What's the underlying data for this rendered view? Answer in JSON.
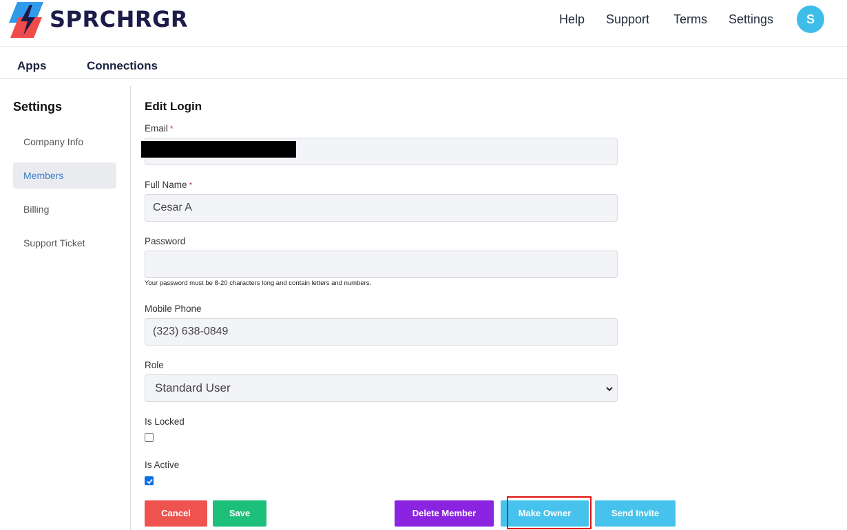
{
  "header": {
    "brand": "SPRCHRGR",
    "nav": [
      "Help",
      "Support",
      "Terms",
      "Settings"
    ],
    "avatar_initial": "S"
  },
  "subnav": [
    "Apps",
    "Connections"
  ],
  "sidebar": {
    "title": "Settings",
    "items": [
      {
        "label": "Company Info",
        "active": false
      },
      {
        "label": "Members",
        "active": true
      },
      {
        "label": "Billing",
        "active": false
      },
      {
        "label": "Support Ticket",
        "active": false
      }
    ]
  },
  "form": {
    "title": "Edit Login",
    "email": {
      "label": "Email",
      "required_mark": "*",
      "value": ""
    },
    "full_name": {
      "label": "Full Name",
      "required_mark": "*",
      "value": "Cesar A"
    },
    "password": {
      "label": "Password",
      "value": "",
      "hint": "Your password must be 8-20 characters long and contain letters and numbers."
    },
    "mobile_phone": {
      "label": "Mobile Phone",
      "value": "(323) 638-0849"
    },
    "role": {
      "label": "Role",
      "value": "Standard User"
    },
    "is_locked": {
      "label": "Is Locked",
      "checked": false
    },
    "is_active": {
      "label": "Is Active",
      "checked": true
    }
  },
  "buttons": {
    "cancel": "Cancel",
    "save": "Save",
    "delete_member": "Delete Member",
    "make_owner": "Make Owner",
    "send_invite": "Send Invite"
  },
  "colors": {
    "cancel": "#ef5350",
    "save": "#1dc07a",
    "delete_member": "#8b24e0",
    "make_owner": "#46c3ec",
    "send_invite": "#46c3ec",
    "highlight": "#e01010"
  }
}
